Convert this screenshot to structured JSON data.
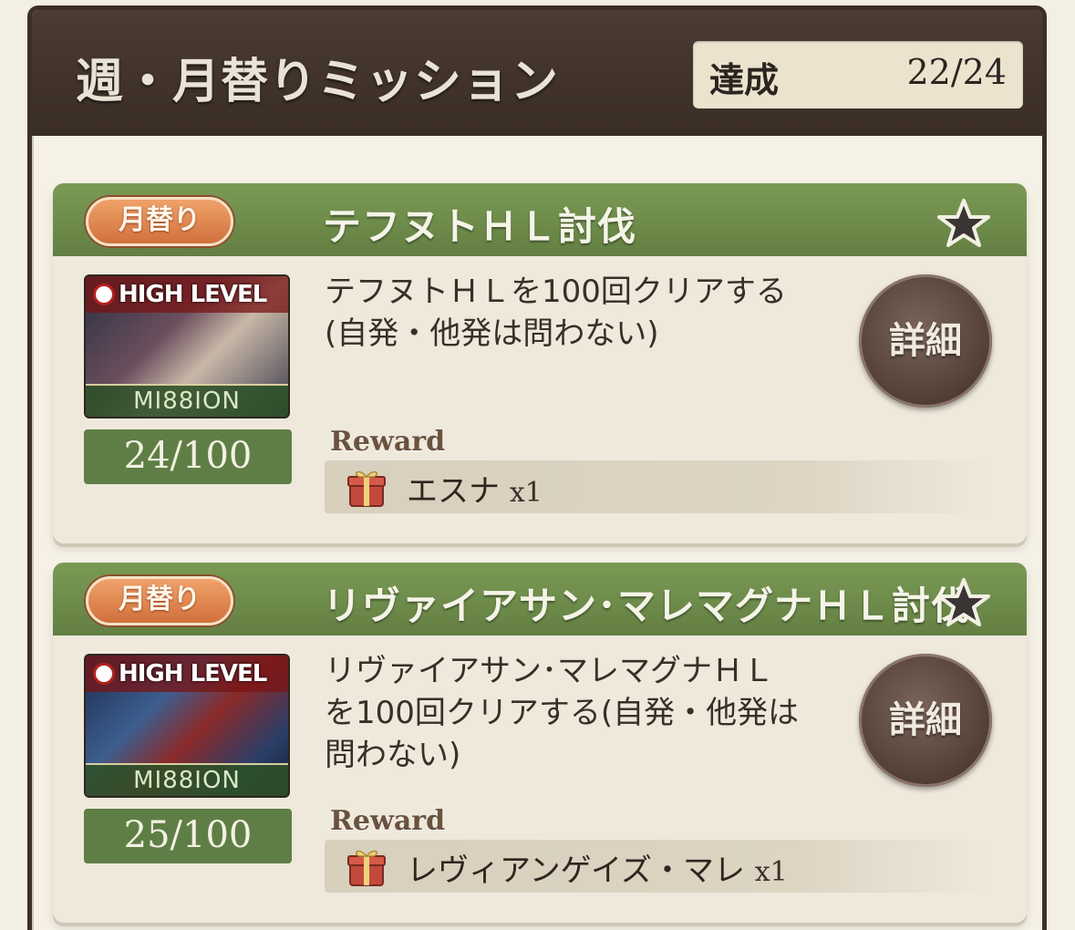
{
  "header": {
    "title": "週・月替りミッション",
    "achieve_label": "達成",
    "achieve_count": "22/24"
  },
  "missions": [
    {
      "badge": "月替り",
      "title": "テフヌトＨＬ討伐",
      "thumb_top": "HIGH LEVEL",
      "thumb_bottom": "MI88ION",
      "progress": "24/100",
      "desc_line1": "テフヌトＨＬを100回クリアする",
      "desc_line2": "(自発・他発は問わない)",
      "desc_line3": "",
      "detail_label": "詳細",
      "reward_label": "Reward",
      "reward_item": "エスナ",
      "reward_qty": "x1"
    },
    {
      "badge": "月替り",
      "title": "リヴァイアサン･マレマグナＨＬ討伐",
      "thumb_top": "HIGH LEVEL",
      "thumb_bottom": "MI88ION",
      "progress": "25/100",
      "desc_line1": "リヴァイアサン･マレマグナＨＬ",
      "desc_line2": "を100回クリアする(自発・他発は",
      "desc_line3": "問わない)",
      "detail_label": "詳細",
      "reward_label": "Reward",
      "reward_item": "レヴィアンゲイズ・マレ",
      "reward_qty": "x1"
    }
  ],
  "icons": {
    "star": "star-icon",
    "gift": "gift-icon"
  },
  "colors": {
    "header_bg": "#3a2d26",
    "card_head": "#6b8a4a",
    "badge": "#e08a52",
    "progress_bg": "#5f7e45"
  }
}
